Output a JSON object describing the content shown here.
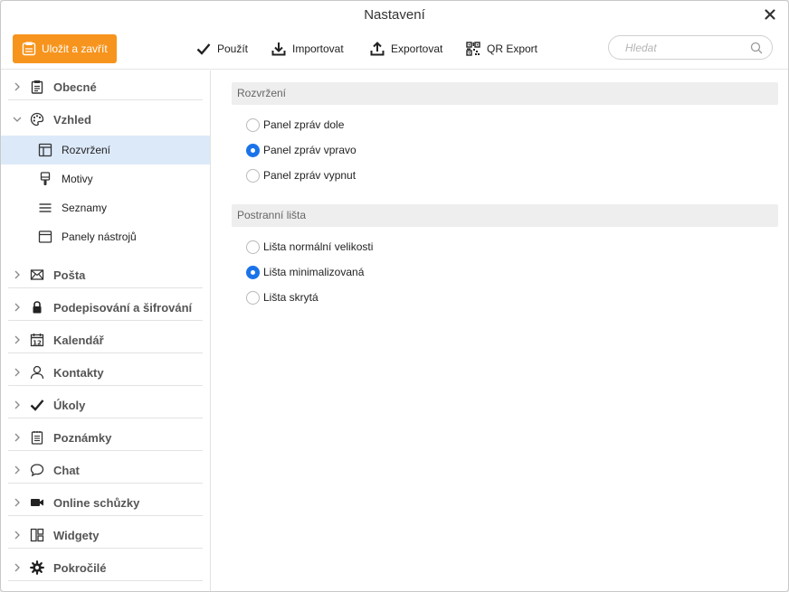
{
  "window": {
    "title": "Nastavení"
  },
  "toolbar": {
    "save_label": "Uložit a zavřít",
    "apply_label": "Použít",
    "import_label": "Importovat",
    "export_label": "Exportovat",
    "qr_label": "QR Export",
    "search_placeholder": "Hledat"
  },
  "sidebar": {
    "general": "Obecné",
    "appearance": "Vzhled",
    "appearance_items": {
      "layout": "Rozvržení",
      "themes": "Motivy",
      "lists": "Seznamy",
      "toolbars": "Panely nástrojů"
    },
    "mail": "Pošta",
    "signing": "Podepisování a šifrování",
    "calendar": "Kalendář",
    "contacts": "Kontakty",
    "tasks": "Úkoly",
    "notes": "Poznámky",
    "chat": "Chat",
    "meetings": "Online schůzky",
    "widgets": "Widgety",
    "advanced": "Pokročilé"
  },
  "content": {
    "layout_header": "Rozvržení",
    "layout_options": [
      "Panel zpráv dole",
      "Panel zpráv vpravo",
      "Panel zpráv vypnut"
    ],
    "layout_selected": "Panel zpráv vpravo",
    "sidebar_header": "Postranní lišta",
    "sidebar_options": [
      "Lišta normální velikosti",
      "Lišta minimalizovaná",
      "Lišta skrytá"
    ],
    "sidebar_selected": "Lišta minimalizovaná"
  },
  "colors": {
    "accent": "#f7941d",
    "selection": "#dce9f9",
    "radio": "#1a73e8"
  }
}
